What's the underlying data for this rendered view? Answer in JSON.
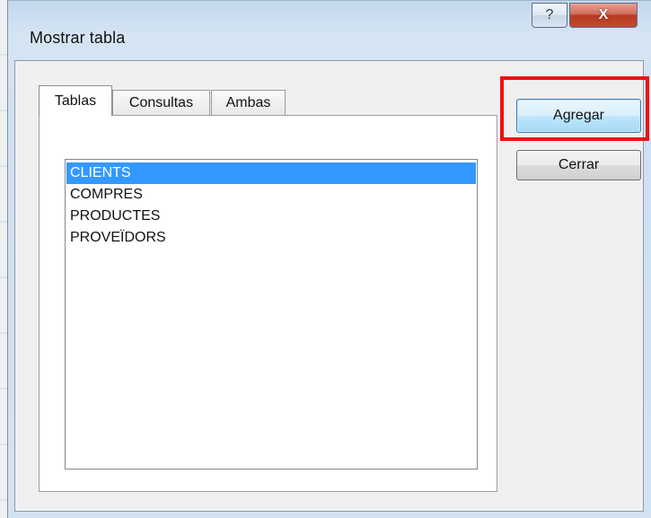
{
  "dialog": {
    "title": "Mostrar tabla",
    "help_label": "?",
    "close_label": "X"
  },
  "tabs": [
    {
      "label": "Tablas",
      "active": true
    },
    {
      "label": "Consultas",
      "active": false
    },
    {
      "label": "Ambas",
      "active": false
    }
  ],
  "list": {
    "items": [
      {
        "label": "CLIENTS",
        "selected": true
      },
      {
        "label": "COMPRES",
        "selected": false
      },
      {
        "label": "PRODUCTES",
        "selected": false
      },
      {
        "label": "PROVEÏDORS",
        "selected": false
      }
    ]
  },
  "buttons": {
    "add_label": "Agregar",
    "close_label": "Cerrar"
  },
  "colors": {
    "selection": "#3399ff",
    "highlight": "#ee1111",
    "close_button": "#c4492f"
  }
}
